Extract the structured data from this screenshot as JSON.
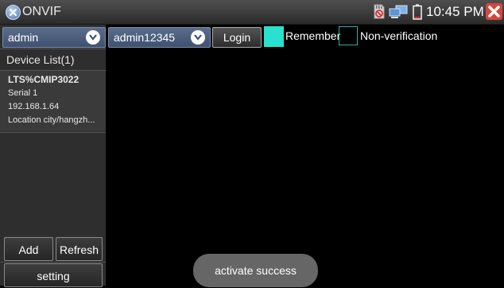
{
  "window": {
    "title": "ONVIF",
    "clock": "10:45 PM",
    "icons": [
      "onvif-logo-icon",
      "sd-card-icon",
      "network-icon",
      "battery-icon",
      "close-icon"
    ]
  },
  "toolbar": {
    "username": "admin",
    "password": "admin12345",
    "login_label": "Login",
    "remember_label": "Remember",
    "remember_checked": true,
    "nonverification_label": "Non-verification",
    "nonverification_checked": false,
    "accent_color": "#29e1cf"
  },
  "sidebar": {
    "header": "Device List(1)",
    "devices": [
      {
        "name": "LTS%CMIP3022",
        "serial": "Serial  1",
        "ip": "192.168.1.64",
        "location": "Location  city/hangzh..."
      }
    ],
    "add_label": "Add",
    "refresh_label": "Refresh",
    "setting_label": "setting"
  },
  "toast": {
    "message": "activate success"
  }
}
